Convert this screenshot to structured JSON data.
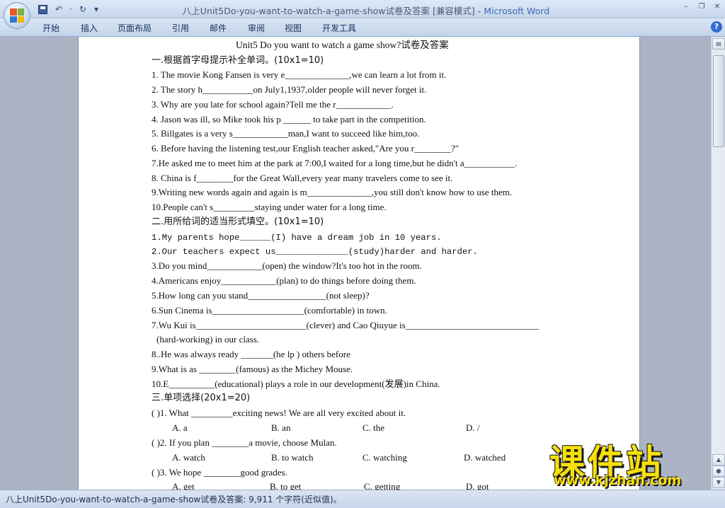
{
  "window": {
    "title_doc": "八上Unit5Do-you-want-to-watch-a-game-show试卷及答案 [兼容模式] - ",
    "title_app": "Microsoft Word"
  },
  "qat": {
    "save": "save-icon",
    "undo": "↶",
    "undo_drop": "·",
    "redo": "↻",
    "customize": "▾"
  },
  "ribbon": {
    "tabs": [
      "开始",
      "插入",
      "页面布局",
      "引用",
      "邮件",
      "审阅",
      "视图",
      "开发工具"
    ],
    "help": "?"
  },
  "window_controls": {
    "minimize": "–",
    "restore": "❐",
    "close": "✕"
  },
  "document": {
    "title": "Unit5 Do you want to watch a game show?试卷及答案",
    "section1": {
      "heading": "一.根据首字母提示补全单词。(10x1=10)",
      "items": [
        "1. The movie Kong Fansen is very e______________,we can learn a lot from it.",
        "2. The story h___________on July1,1937,older people will never forget it.",
        "3. Why are you late for school again?Tell me the r____________.",
        "4. Jason was ill, so Mike took his p ______ to take part in the competition.",
        "5. Billgates is a very s____________man,I want to succeed like him,too.",
        "6. Before having the listening test,our English teacher asked,\"Are you r________?\"",
        "7.He asked me to meet him at the park at 7:00,I waited for a long time,but he didn't a___________.",
        "8. China is f________for the Great Wall,every year many travelers come to see it.",
        "9.Writing new words again and again is m______________,you still don't know how to use them.",
        "10.People can't s_________staying under water for a long time."
      ]
    },
    "section2": {
      "heading": "二.用所给词的适当形式填空。(10x1=10)",
      "items": [
        "1.My parents hope______(I) have a dream job in 10 years.",
        "2.Our teachers expect us______________(study)harder and harder.",
        "3.Do you mind____________(open) the window?It's too hot in the room.",
        "4.Americans enjoy____________(plan) to do things before doing them.",
        "5.How long can you stand_________________(not sleep)?",
        "6.Sun Cinema is____________________(comfortable) in town.",
        "7.Wu Kui is________________________(clever) and Cao Qiuyue is_____________________________",
        "(hard-working) in our class.",
        "8..He was always ready _______(he lp ) others before",
        "9.What is as ________(famous) as the Michey Mouse.",
        "10.E__________(educational) plays a role in our development(发展)in China."
      ]
    },
    "section3": {
      "heading": "三.单项选择(20x1=20)",
      "questions": [
        {
          "q": "(    )1. What _________exciting news! We are all very excited about it.",
          "options": [
            "A. a",
            "B. an",
            "C. the",
            "D. /"
          ]
        },
        {
          "q": "(    )2. If you plan ________a movie, choose Mulan.",
          "options": [
            "A. watch",
            "B. to watch",
            "C. watching",
            "D. watched"
          ]
        },
        {
          "q": "(    )3. We hope ________good grades.",
          "options": [
            "A. get",
            "B. to get",
            "C. getting",
            "D. got"
          ]
        }
      ]
    }
  },
  "statusbar": {
    "text": "八上Unit5Do-you-want-to-watch-a-game-show试卷及答案: 9,911 个字符(近似值)。"
  },
  "watermark": {
    "cn": "课件站",
    "url": "www.kjzhan.com"
  }
}
